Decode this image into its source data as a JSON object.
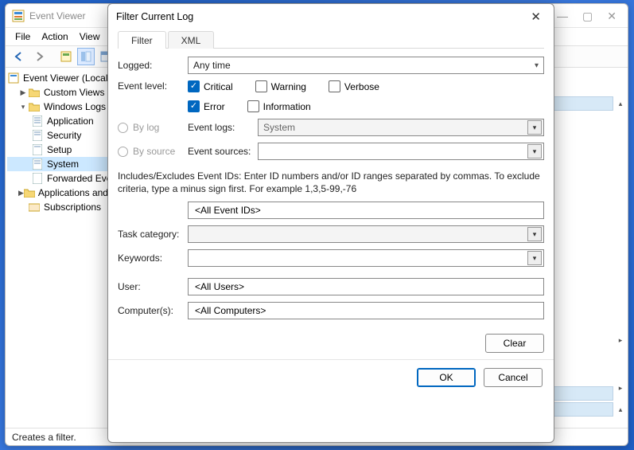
{
  "main_window": {
    "title": "Event Viewer",
    "menu": {
      "file": "File",
      "action": "Action",
      "view": "View"
    },
    "tree": {
      "root": "Event Viewer (Local)",
      "custom_views": "Custom Views",
      "windows_logs": "Windows Logs",
      "application": "Application",
      "security": "Security",
      "setup": "Setup",
      "system": "System",
      "forwarded": "Forwarded Events",
      "apps_services": "Applications and Services Logs",
      "subscriptions": "Subscriptions"
    },
    "status": "Creates a filter."
  },
  "dialog": {
    "title": "Filter Current Log",
    "tabs": {
      "filter": "Filter",
      "xml": "XML"
    },
    "labels": {
      "logged": "Logged:",
      "event_level": "Event level:",
      "by_log": "By log",
      "by_source": "By source",
      "event_logs": "Event logs:",
      "event_sources": "Event sources:",
      "task_category": "Task category:",
      "keywords": "Keywords:",
      "user": "User:",
      "computers": "Computer(s):"
    },
    "logged_value": "Any time",
    "levels": {
      "critical": "Critical",
      "warning": "Warning",
      "verbose": "Verbose",
      "error": "Error",
      "information": "Information"
    },
    "event_logs_value": "System",
    "ids_description": "Includes/Excludes Event IDs: Enter ID numbers and/or ID ranges separated by commas. To exclude criteria, type a minus sign first. For example 1,3,5-99,-76",
    "ids_placeholder": "<All Event IDs>",
    "user_value": "<All Users>",
    "computers_value": "<All Computers>",
    "buttons": {
      "clear": "Clear",
      "ok": "OK",
      "cancel": "Cancel"
    }
  }
}
